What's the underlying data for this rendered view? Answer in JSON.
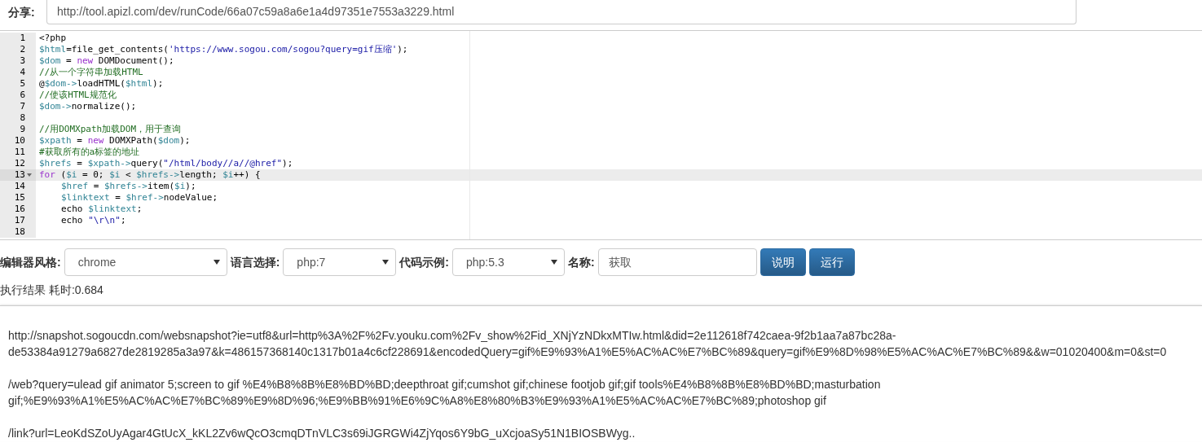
{
  "share": {
    "label": "分享:",
    "url": "http://tool.apizl.com/dev/runCode/66a07c59a8a6e1a4d97351e7553a3229.html"
  },
  "editor": {
    "lines": [
      {
        "number": "1",
        "active": false,
        "fold": false,
        "tokens": [
          {
            "kind": "plain",
            "text": "<?php"
          }
        ]
      },
      {
        "number": "2",
        "active": false,
        "fold": false,
        "tokens": [
          {
            "kind": "var",
            "text": "$html"
          },
          {
            "kind": "plain",
            "text": "=file_get_contents("
          },
          {
            "kind": "string",
            "text": "'https://www.sogou.com/sogou?query=gif压缩'"
          },
          {
            "kind": "plain",
            "text": ");"
          }
        ]
      },
      {
        "number": "3",
        "active": false,
        "fold": false,
        "tokens": [
          {
            "kind": "var",
            "text": "$dom"
          },
          {
            "kind": "plain",
            "text": " = "
          },
          {
            "kind": "keyword",
            "text": "new"
          },
          {
            "kind": "plain",
            "text": " DOMDocument();"
          }
        ]
      },
      {
        "number": "4",
        "active": false,
        "fold": false,
        "tokens": [
          {
            "kind": "comment",
            "text": "//从一个字符串加载HTML"
          }
        ]
      },
      {
        "number": "5",
        "active": false,
        "fold": false,
        "tokens": [
          {
            "kind": "plain",
            "text": "@"
          },
          {
            "kind": "var",
            "text": "$dom->"
          },
          {
            "kind": "plain",
            "text": "loadHTML("
          },
          {
            "kind": "var",
            "text": "$html"
          },
          {
            "kind": "plain",
            "text": ");"
          }
        ]
      },
      {
        "number": "6",
        "active": false,
        "fold": false,
        "tokens": [
          {
            "kind": "comment",
            "text": "//使该HTML规范化"
          }
        ]
      },
      {
        "number": "7",
        "active": false,
        "fold": false,
        "tokens": [
          {
            "kind": "var",
            "text": "$dom->"
          },
          {
            "kind": "plain",
            "text": "normalize();"
          }
        ]
      },
      {
        "number": "8",
        "active": false,
        "fold": false
      },
      {
        "number": "9",
        "active": false,
        "fold": false,
        "tokens": [
          {
            "kind": "comment",
            "text": "//用DOMXpath加载DOM，用于查询"
          }
        ]
      },
      {
        "number": "10",
        "active": false,
        "fold": false,
        "tokens": [
          {
            "kind": "var",
            "text": "$xpath"
          },
          {
            "kind": "plain",
            "text": " = "
          },
          {
            "kind": "keyword",
            "text": "new"
          },
          {
            "kind": "plain",
            "text": " DOMXPath("
          },
          {
            "kind": "var",
            "text": "$dom"
          },
          {
            "kind": "plain",
            "text": ");"
          }
        ]
      },
      {
        "number": "11",
        "active": false,
        "fold": false,
        "tokens": [
          {
            "kind": "comment",
            "text": "#获取所有的a标签的地址"
          }
        ]
      },
      {
        "number": "12",
        "active": false,
        "fold": false,
        "tokens": [
          {
            "kind": "var",
            "text": "$hrefs"
          },
          {
            "kind": "plain",
            "text": " = "
          },
          {
            "kind": "var",
            "text": "$xpath->"
          },
          {
            "kind": "plain",
            "text": "query("
          },
          {
            "kind": "string",
            "text": "\"/html/body//a//@href\""
          },
          {
            "kind": "plain",
            "text": ");"
          }
        ]
      },
      {
        "number": "13",
        "active": true,
        "fold": true,
        "tokens": [
          {
            "kind": "keyword",
            "text": "for"
          },
          {
            "kind": "plain",
            "text": " ("
          },
          {
            "kind": "var",
            "text": "$i"
          },
          {
            "kind": "plain",
            "text": " = 0; "
          },
          {
            "kind": "var",
            "text": "$i"
          },
          {
            "kind": "plain",
            "text": " < "
          },
          {
            "kind": "var",
            "text": "$hrefs->"
          },
          {
            "kind": "plain",
            "text": "length; "
          },
          {
            "kind": "var",
            "text": "$i"
          },
          {
            "kind": "plain",
            "text": "++) {"
          }
        ]
      },
      {
        "number": "14",
        "active": false,
        "fold": false,
        "indented": true,
        "tokens": [
          {
            "kind": "var",
            "text": "$href"
          },
          {
            "kind": "plain",
            "text": " = "
          },
          {
            "kind": "var",
            "text": "$hrefs->"
          },
          {
            "kind": "plain",
            "text": "item("
          },
          {
            "kind": "var",
            "text": "$i"
          },
          {
            "kind": "plain",
            "text": ");"
          }
        ]
      },
      {
        "number": "15",
        "active": false,
        "fold": false,
        "indented": true,
        "tokens": [
          {
            "kind": "var",
            "text": "$linktext"
          },
          {
            "kind": "plain",
            "text": " = "
          },
          {
            "kind": "var",
            "text": "$href->"
          },
          {
            "kind": "plain",
            "text": "nodeValue;"
          }
        ]
      },
      {
        "number": "16",
        "active": false,
        "fold": false,
        "indented": true,
        "tokens": [
          {
            "kind": "plain",
            "text": "echo "
          },
          {
            "kind": "var",
            "text": "$linktext"
          },
          {
            "kind": "plain",
            "text": ";"
          }
        ]
      },
      {
        "number": "17",
        "active": false,
        "fold": false,
        "indented": true,
        "tokens": [
          {
            "kind": "plain",
            "text": "echo "
          },
          {
            "kind": "string",
            "text": "\"\\r\\n\""
          },
          {
            "kind": "plain",
            "text": ";"
          }
        ]
      },
      {
        "number": "18",
        "active": false,
        "fold": false
      }
    ]
  },
  "controls": {
    "theme_label": "编辑器风格:",
    "theme": "chrome",
    "language_label": "语言选择:",
    "language": "php:7",
    "example_label": "代码示例:",
    "example": "php:5.3",
    "name_label": "名称:",
    "name": "获取",
    "buttons": [
      "说明",
      "运行"
    ]
  },
  "result": {
    "title": "执行结果 耗时:0.684",
    "paragraphs": [
      "http://snapshot.sogoucdn.com/websnapshot?ie=utf8&url=http%3A%2F%2Fv.youku.com%2Fv_show%2Fid_XNjYzNDkxMTIw.html&did=2e112618f742caea-9f2b1aa7a87bc28a-de53384a91279a6827de2819285a3a97&k=486157368140c1317b01a4c6cf228691&encodedQuery=gif%E9%93%A1%E5%AC%AC%E7%BC%89&query=gif%E9%8D%98%E5%AC%AC%E7%BC%89&&w=01020400&m=0&st=0",
      "/web?query=ulead gif animator 5;screen to gif %E4%B8%8B%E8%BD%BD;deepthroat gif;cumshot gif;chinese footjob gif;gif tools%E4%B8%8B%E8%BD%BD;masturbation gif;%E9%93%A1%E5%AC%AC%E7%BC%89%E9%8D%96;%E9%BB%91%E6%9C%A8%E8%80%B3%E9%93%A1%E5%AC%AC%E7%BC%89;photoshop gif",
      "/link?url=LeoKdSZoUyAgar4GtUcX_kKL2Zv6wQcO3cmqDTnVLC3s69iJGRGWi4ZjYqos6Y9bG_uXcjoaSy51N1BIOSBWyg.."
    ]
  }
}
